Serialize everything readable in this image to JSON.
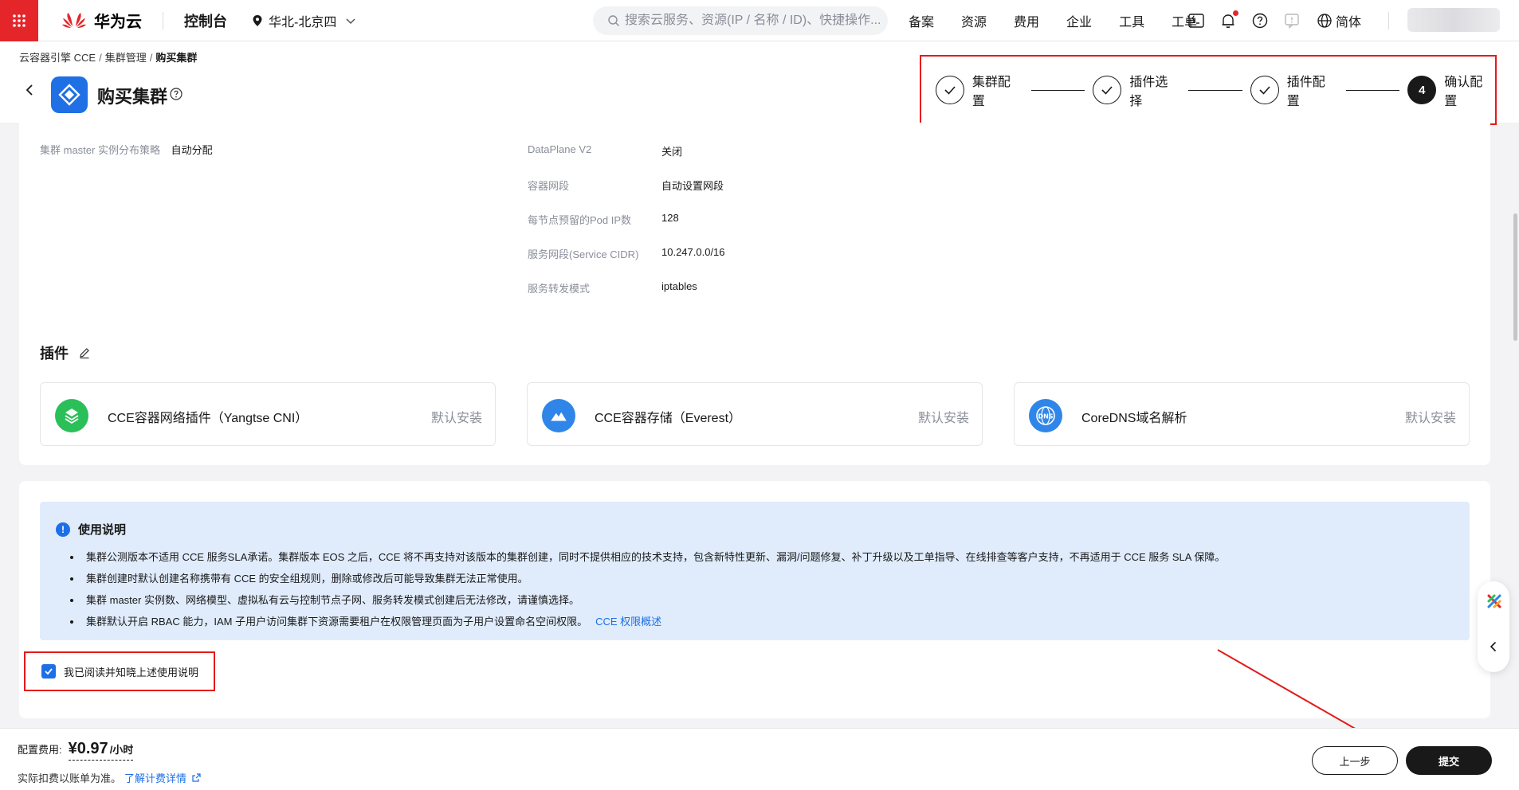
{
  "topnav": {
    "logo_text": "华为云",
    "console": "控制台",
    "region": "华北-北京四",
    "search_placeholder": "搜索云服务、资源(IP / 名称 / ID)、快捷操作...",
    "links": [
      "备案",
      "资源",
      "费用",
      "企业",
      "工具",
      "工单"
    ],
    "lang": "简体"
  },
  "breadcrumb": {
    "items": [
      "云容器引擎 CCE",
      "集群管理",
      "购买集群"
    ]
  },
  "header": {
    "title": "购买集群"
  },
  "steps": [
    {
      "label": "集群配置",
      "status": "done"
    },
    {
      "label": "插件选择",
      "status": "done"
    },
    {
      "label": "插件配置",
      "status": "done"
    },
    {
      "label": "确认配置",
      "status": "active",
      "number": "4"
    }
  ],
  "config": {
    "left": [
      {
        "key": "集群 master 实例分布策略",
        "value": "自动分配"
      }
    ],
    "right": [
      {
        "key": "DataPlane V2",
        "value": "关闭"
      },
      {
        "key": "容器网段",
        "value": "自动设置网段"
      },
      {
        "key": "每节点预留的Pod IP数",
        "value": "128"
      },
      {
        "key": "服务网段(Service CIDR)",
        "value": "10.247.0.0/16"
      },
      {
        "key": "服务转发模式",
        "value": "iptables"
      }
    ]
  },
  "addons": {
    "title": "插件",
    "items": [
      {
        "name": "CCE容器网络插件（Yangtse CNI）",
        "status": "默认安装",
        "color": "#2bbf5a"
      },
      {
        "name": "CCE容器存储（Everest）",
        "status": "默认安装",
        "color": "#2f86e8"
      },
      {
        "name": "CoreDNS域名解析",
        "status": "默认安装",
        "color": "#2f86e8",
        "icon_text": "DNS"
      }
    ]
  },
  "notice": {
    "title": "使用说明",
    "items": [
      "集群公测版本不适用 CCE 服务SLA承诺。集群版本 EOS 之后，CCE 将不再支持对该版本的集群创建，同时不提供相应的技术支持，包含新特性更新、漏洞/问题修复、补丁升级以及工单指导、在线排查等客户支持，不再适用于 CCE 服务 SLA 保障。",
      "集群创建时默认创建名称携带有 CCE 的安全组规则，删除或修改后可能导致集群无法正常使用。",
      "集群 master 实例数、网络模型、虚拟私有云与控制节点子网、服务转发模式创建后无法修改，请谨慎选择。",
      "集群默认开启 RBAC 能力，IAM 子用户访问集群下资源需要租户在权限管理页面为子用户设置命名空间权限。"
    ],
    "link": "CCE 权限概述"
  },
  "agree": {
    "label": "我已阅读并知晓上述使用说明",
    "checked": true
  },
  "footer": {
    "fee_label": "配置费用:",
    "price": "¥0.97",
    "unit": "/小时",
    "note": "实际扣费以账单为准。",
    "note_link": "了解计费详情",
    "prev_label": "上一步",
    "submit_label": "提交"
  },
  "colors": {
    "brand_red": "#e4262b",
    "annotation_red": "#e51a1a",
    "link_blue": "#1d6fe5",
    "notice_bg": "#e0ecfc"
  }
}
